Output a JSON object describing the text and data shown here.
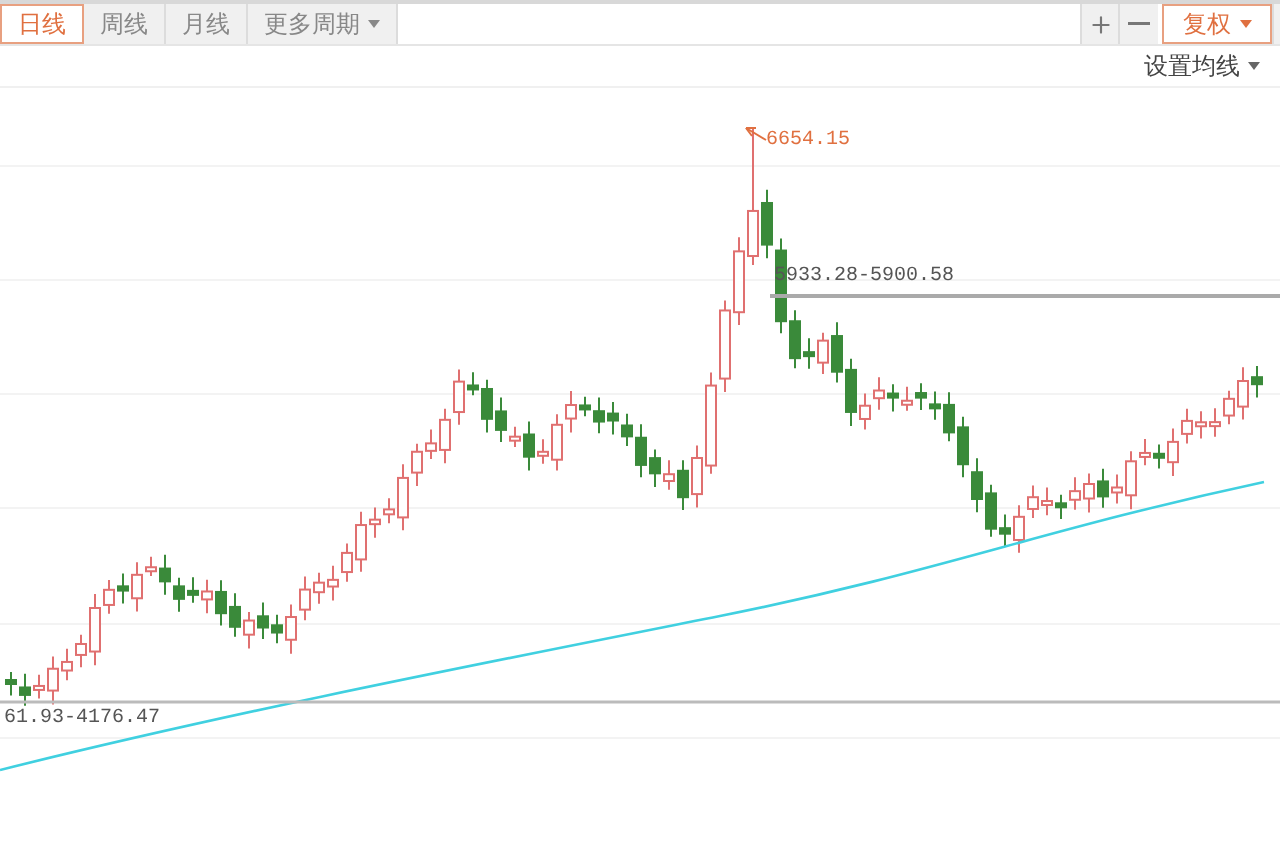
{
  "period_tabs": [
    {
      "label": "日线",
      "selected": true,
      "kind": "plain"
    },
    {
      "label": "周线",
      "selected": false,
      "kind": "plain"
    },
    {
      "label": "月线",
      "selected": false,
      "kind": "plain"
    },
    {
      "label": "更多周期",
      "selected": false,
      "kind": "dropdown"
    }
  ],
  "adjust_button": {
    "label": "复权",
    "active": true
  },
  "ma_settings": {
    "label": "设置均线"
  },
  "chart": {
    "peak_label": "6654.15",
    "upper_range_label": "5933.28-5900.58",
    "lower_range_label": "61.93-4176.47"
  }
}
